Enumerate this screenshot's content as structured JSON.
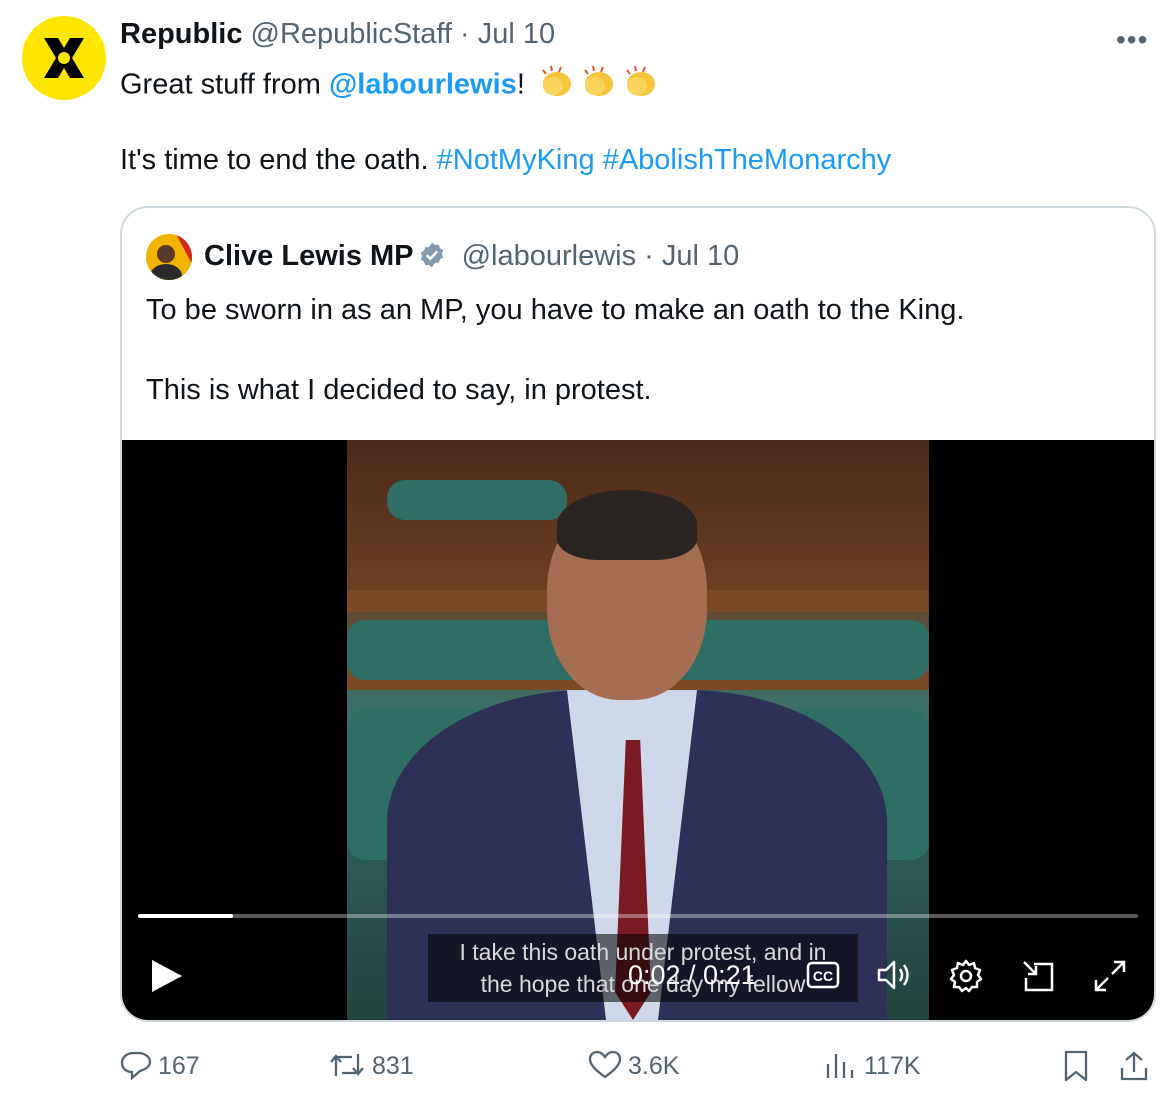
{
  "post": {
    "author_name": "Republic",
    "handle": "@RepublicStaff",
    "separator": "·",
    "date": "Jul 10",
    "line1_prefix": "Great stuff from ",
    "line1_mention": "@labourlewis",
    "line1_suffix": "!",
    "line2_text": "It's time to end the oath. ",
    "hashtag1": "#NotMyKing",
    "hashtag2": "#AbolishTheMonarchy",
    "more_label": "•••"
  },
  "quote": {
    "author_name": "Clive Lewis MP",
    "handle": "@labourlewis",
    "separator": "·",
    "date": "Jul 10",
    "text1": "To be sworn in as an MP, you have to make an oath to the King.",
    "text2": "This is what I decided to say, in protest.",
    "video": {
      "caption_line1": "I take this oath under protest, and in",
      "caption_line2": "the hope that one day my fellow",
      "time_display": "0:02 / 0:21",
      "current_seconds": 2,
      "duration_seconds": 21
    }
  },
  "actions": {
    "replies": "167",
    "reposts": "831",
    "likes": "3.6K",
    "views": "117K"
  },
  "colors": {
    "link": "#1d9bf0",
    "muted": "#536471",
    "brand_yellow": "#ffe500",
    "verified": "#829aab"
  }
}
